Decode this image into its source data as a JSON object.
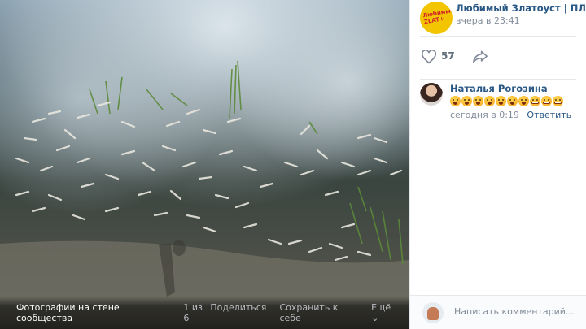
{
  "photo": {
    "album": "Фотографии на стене сообщества",
    "counter": "1 из 6",
    "share_label": "Поделиться",
    "save_label": "Сохранить к себе",
    "more_label": "Ещё"
  },
  "post": {
    "group_name": "Любимый Златоуст | ПЛЮС",
    "time": "вчера в 23:41",
    "likes": "57"
  },
  "comment": {
    "author": "Наталья Рогозина",
    "emojis": [
      "astonished",
      "astonished",
      "astonished",
      "astonished",
      "weary",
      "weary",
      "weary",
      "grimacing",
      "grimacing",
      "grimacing"
    ],
    "time": "сегодня в 0:19",
    "reply_label": "Ответить"
  },
  "composer": {
    "placeholder": "Написать комментарий..."
  },
  "colors": {
    "link": "#2a5885",
    "meta": "#818c99",
    "brand_yellow": "#f2c500"
  }
}
